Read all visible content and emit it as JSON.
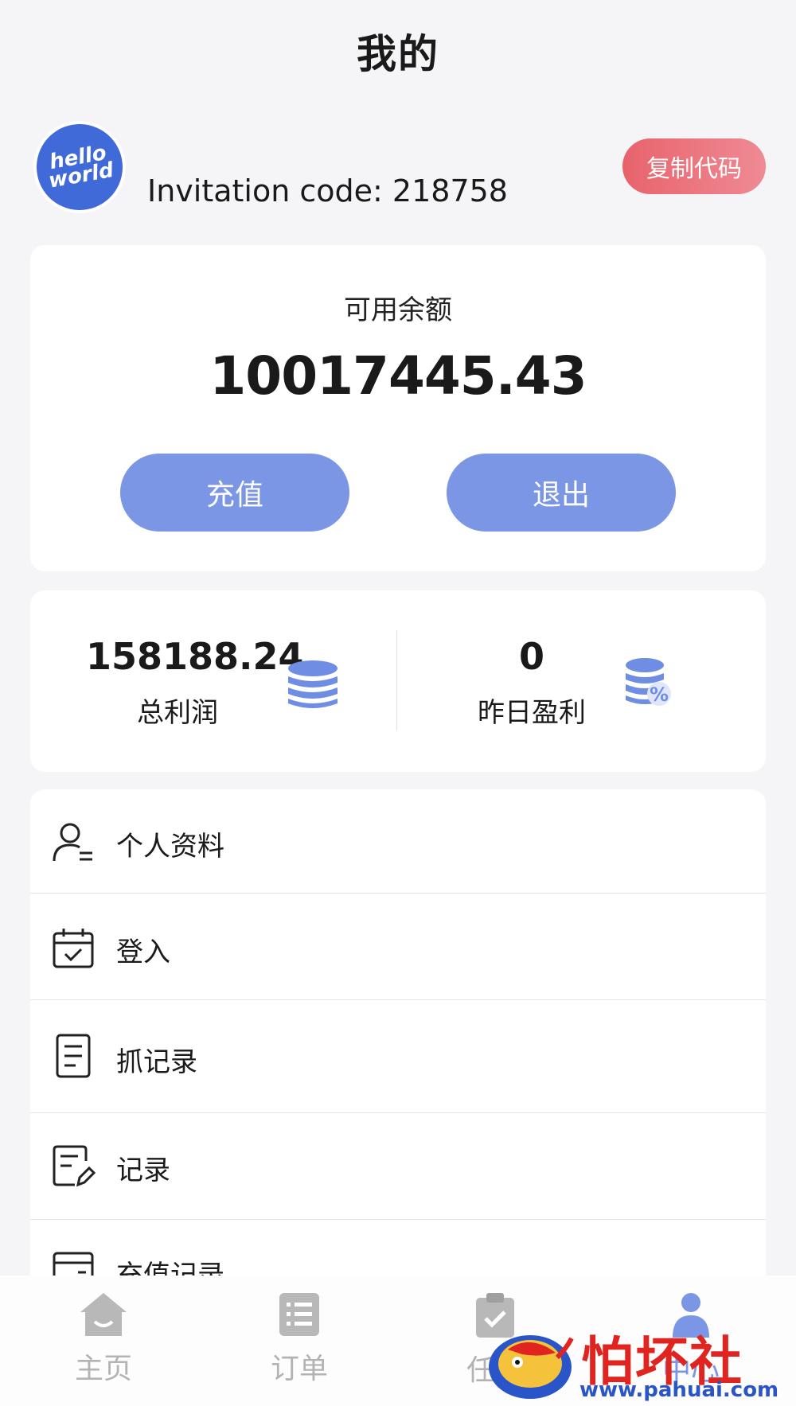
{
  "header": {
    "title": "我的"
  },
  "profile": {
    "avatar_text_line1": "hello",
    "avatar_text_line2": "world",
    "invitation_label": "Invitation code: 218758",
    "copy_button_label": "复制代码"
  },
  "balance": {
    "label": "可用余额",
    "value": "10017445.43",
    "recharge_label": "充值",
    "logout_label": "退出"
  },
  "stats": {
    "total_profit_value": "158188.24",
    "total_profit_label": "总利润",
    "yesterday_profit_value": "0",
    "yesterday_profit_label": "昨日盈利"
  },
  "menu": {
    "items": [
      {
        "label": "个人资料",
        "icon": "user-profile-icon"
      },
      {
        "label": "登入",
        "icon": "calendar-check-icon"
      },
      {
        "label": "抓记录",
        "icon": "document-icon"
      },
      {
        "label": "记录",
        "icon": "edit-record-icon"
      },
      {
        "label": "充值记录",
        "icon": "wallet-icon"
      }
    ]
  },
  "tabbar": {
    "tabs": [
      {
        "label": "主页",
        "icon": "home-icon",
        "active": false
      },
      {
        "label": "订单",
        "icon": "list-icon",
        "active": false
      },
      {
        "label": "任务",
        "icon": "clipboard-check-icon",
        "active": false
      },
      {
        "label": "中心",
        "icon": "person-icon",
        "active": true
      }
    ]
  },
  "watermark": {
    "text": "怕坏社区",
    "url": "www.pahuai.com"
  },
  "colors": {
    "accent_blue": "#7c96e6",
    "copy_button": "#e8636c",
    "watermark_red": "#e0241f",
    "watermark_blue": "#2a55c8"
  }
}
